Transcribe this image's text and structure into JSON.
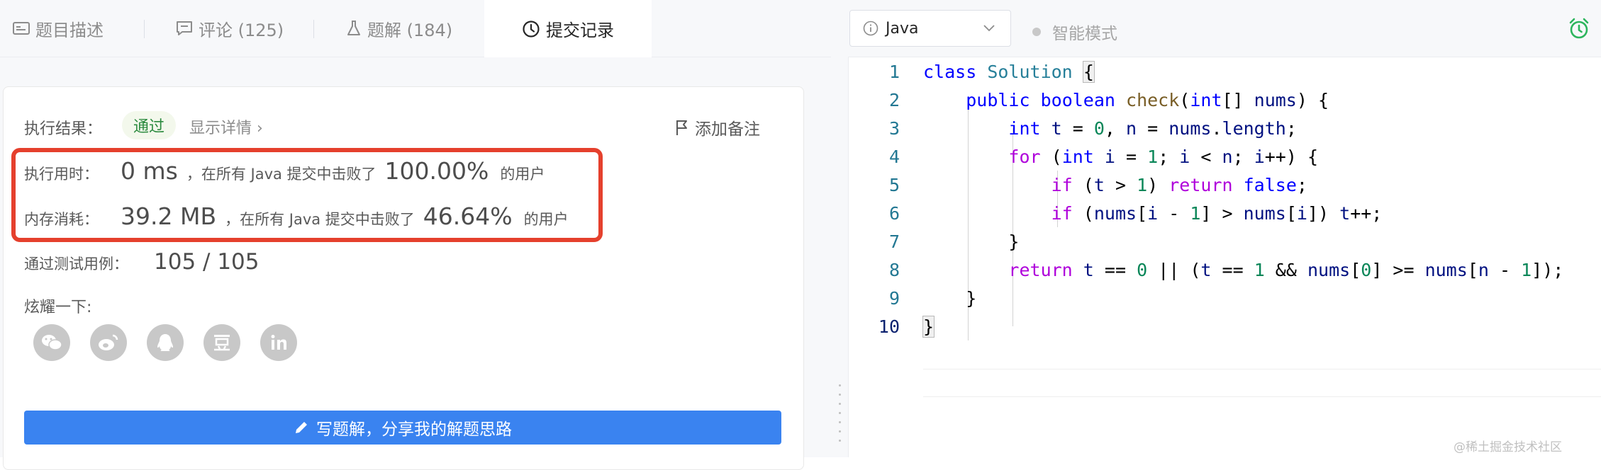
{
  "tabs": [
    {
      "label": "题目描述"
    },
    {
      "label": "评论 (125)"
    },
    {
      "label": "题解 (184)"
    },
    {
      "label": "提交记录"
    }
  ],
  "result": {
    "label": "执行结果：",
    "status": "通过",
    "detail_link": "显示详情 ›",
    "add_note": "添加备注"
  },
  "runtime": {
    "label": "执行用时：",
    "value": "0 ms",
    "middle": "，在所有 Java 提交中击败了",
    "percent": "100.00%",
    "suffix": "的用户"
  },
  "memory": {
    "label": "内存消耗：",
    "value": "39.2 MB",
    "middle": "，在所有 Java 提交中击败了",
    "percent": "46.64%",
    "suffix": "的用户"
  },
  "testcases": {
    "label": "通过测试用例：",
    "value": "105 / 105"
  },
  "share": {
    "title": "炫耀一下:",
    "buttons": [
      "wechat-icon",
      "weibo-icon",
      "qq-icon",
      "douban-icon",
      "linkedin-icon"
    ]
  },
  "write_button": "写题解，分享我的解题思路",
  "editor": {
    "language": "Java",
    "smart_mode": "智能模式",
    "line_numbers": [
      "1",
      "2",
      "3",
      "4",
      "5",
      "6",
      "7",
      "8",
      "9",
      "10"
    ]
  },
  "watermark": "@稀土掘金技术社区"
}
